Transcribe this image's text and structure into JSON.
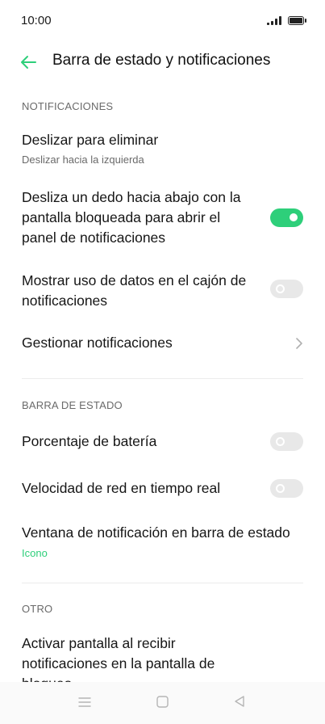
{
  "status_bar": {
    "time": "10:00"
  },
  "header": {
    "title": "Barra de estado y notificaciones"
  },
  "sections": {
    "notifications": {
      "label": "NOTIFICACIONES",
      "swipe": {
        "title": "Deslizar para eliminar",
        "subtitle": "Deslizar hacia la izquierda"
      },
      "pulldown": {
        "title": "Desliza un dedo hacia abajo con la pantalla bloqueada para abrir el panel de notificaciones",
        "enabled": true
      },
      "data_usage": {
        "title": "Mostrar uso de datos en el cajón de notificaciones",
        "enabled": false
      },
      "manage": {
        "title": "Gestionar notificaciones"
      }
    },
    "status_bar": {
      "label": "BARRA DE ESTADO",
      "battery": {
        "title": "Porcentaje de batería",
        "enabled": false
      },
      "speed": {
        "title": "Velocidad de red en tiempo real",
        "enabled": false
      },
      "window": {
        "title": "Ventana de notificación en barra de estado",
        "value": "Icono"
      }
    },
    "other": {
      "label": "OTRO",
      "wake": {
        "title": "Activar pantalla al recibir notificaciones en la pantalla de bloqueo"
      }
    }
  },
  "colors": {
    "accent": "#2ecf7a",
    "toggle_off": "#e8e8e8"
  },
  "icons": [
    "back-arrow-icon",
    "chevron-right-icon",
    "signal-icon",
    "battery-icon",
    "menu-icon",
    "home-icon",
    "back-icon"
  ]
}
